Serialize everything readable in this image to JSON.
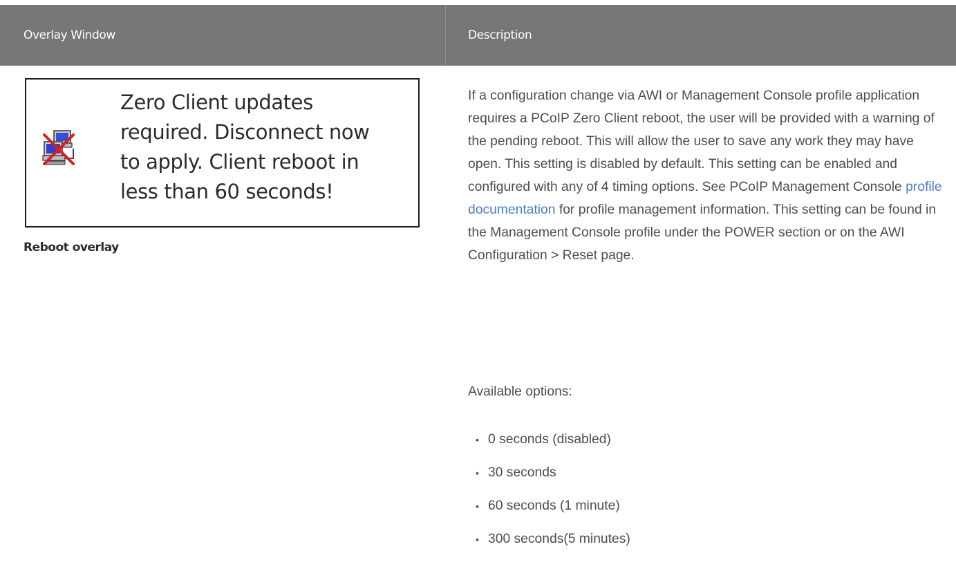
{
  "table": {
    "headers": [
      "Overlay Window",
      "Description"
    ]
  },
  "overlay": {
    "icon": "disconnected-computer-icon",
    "text_lines": [
      "Zero Client updates",
      "required. Disconnect now",
      "to apply. Client reboot in",
      "less than 60 seconds!"
    ],
    "caption": "Reboot overlay"
  },
  "description": {
    "before_link": "If a configuration change via AWI or Management Console profile application requires a PCoIP Zero Client reboot, the user will be provided with a warning of the pending reboot. This will allow the user to save any work they may have open. This setting is disabled by default. This setting can be enabled and configured with any of 4 timing options. See PCoIP Management Console ",
    "link_text": "profile documentation",
    "after_link": " for profile management information. This setting can be found in the Management Console profile under the POWER section or on the AWI Configuration > Reset page.",
    "options_label": "Available options:",
    "options": [
      "0 seconds (disabled)",
      "30 seconds",
      "60 seconds (1 minute)",
      "300 seconds(5 minutes)"
    ]
  },
  "colors": {
    "header_bg": "#767676",
    "link": "#4a7bd0"
  }
}
